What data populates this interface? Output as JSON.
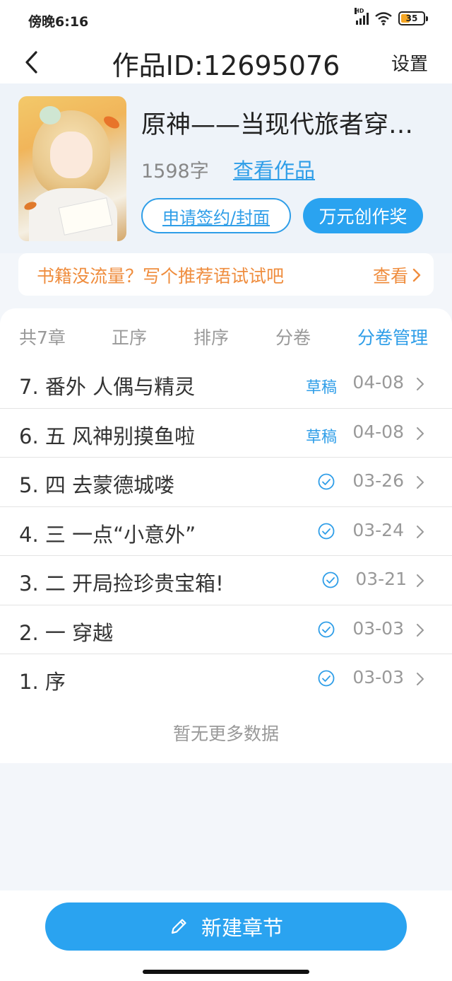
{
  "status_bar": {
    "time": "傍晚6:16",
    "battery": "35",
    "hd": "HD"
  },
  "header": {
    "title": "作品ID:12695076",
    "settings_label": "设置"
  },
  "book": {
    "title": "原神——当现代旅者穿…",
    "word_count": "1598字",
    "view_label": "查看作品",
    "sign_label": "申请签约/封面",
    "award_label": "万元创作奖"
  },
  "recommend": {
    "text": "书籍没流量？写个推荐语试试吧",
    "action": "查看"
  },
  "tabs": {
    "count": "共7章",
    "order": "正序",
    "sort": "排序",
    "volume": "分卷",
    "volume_manage": "分卷管理"
  },
  "chapters": [
    {
      "name": "7. 番外 人偶与精灵",
      "status": "草稿",
      "date": "04-08"
    },
    {
      "name": "6. 五 风神别摸鱼啦",
      "status": "草稿",
      "date": "04-08"
    },
    {
      "name": "5. 四 去蒙德城喽",
      "status": "published",
      "date": "03-26"
    },
    {
      "name": "4. 三 一点“小意外”",
      "status": "published",
      "date": "03-24"
    },
    {
      "name": "3. 二 开局捡珍贵宝箱!",
      "status": "published",
      "date": "03-21"
    },
    {
      "name": "2. 一 穿越",
      "status": "published",
      "date": "03-03"
    },
    {
      "name": "1. 序",
      "status": "published",
      "date": "03-03"
    }
  ],
  "no_more": "暂无更多数据",
  "new_chapter_label": "新建章节",
  "colors": {
    "accent": "#2aa3f0",
    "link": "#2f9ee8",
    "orange": "#ef8d3e"
  },
  "icons": {
    "back": "chevron-left-icon",
    "check": "check-circle-icon",
    "chevron": "chevron-right-icon",
    "edit": "pencil-icon"
  }
}
